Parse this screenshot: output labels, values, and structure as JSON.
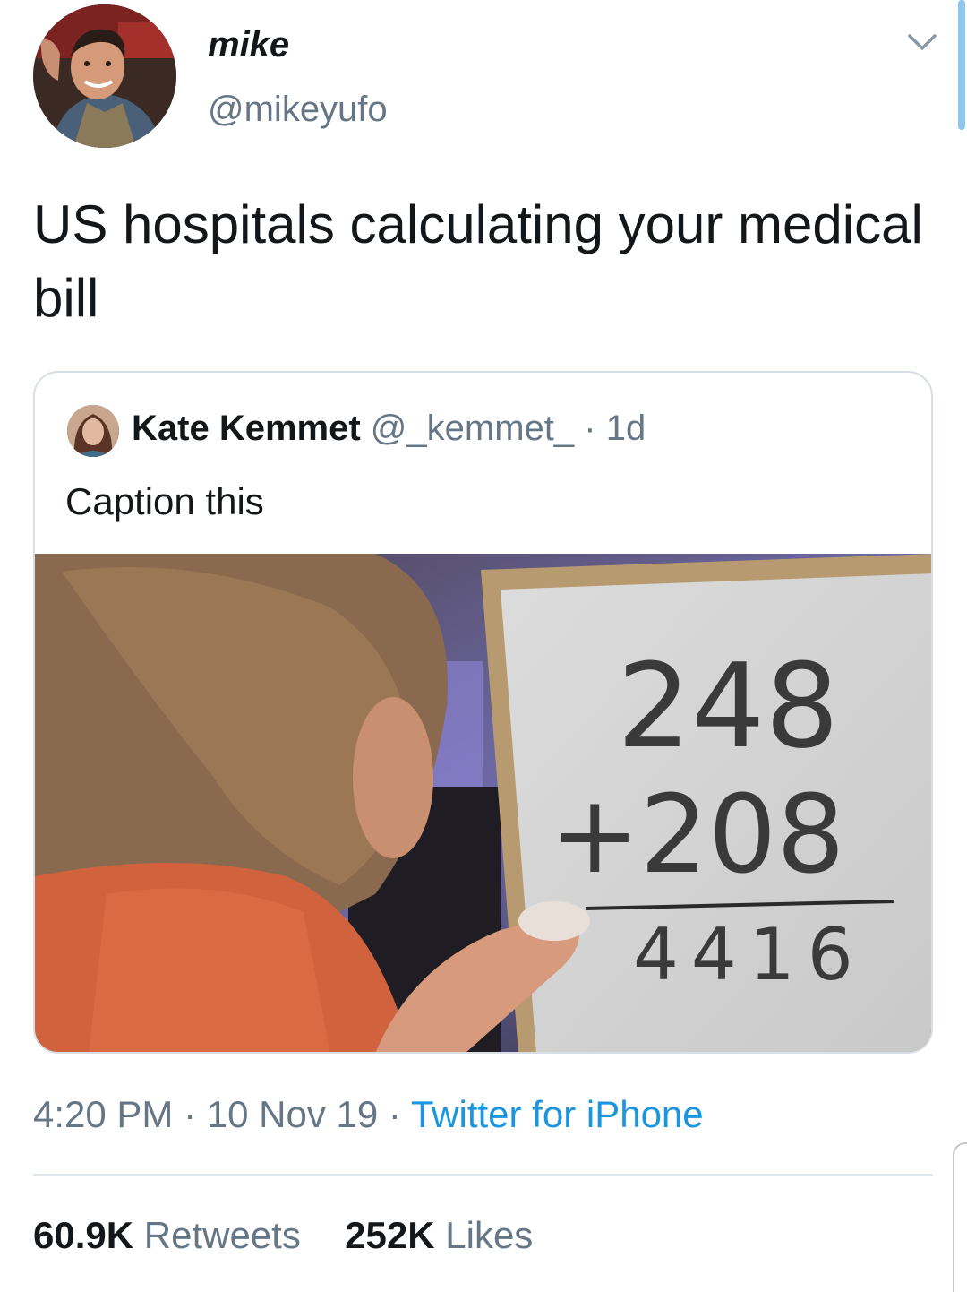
{
  "author": {
    "display_name": "mike",
    "handle": "@mikeyufo"
  },
  "tweet": {
    "text": "US hospitals calculating your medical bill"
  },
  "quoted_tweet": {
    "author_name": "Kate Kemmet",
    "author_handle": "@_kemmet_",
    "separator": "·",
    "age": "1d",
    "text": "Caption this",
    "media": {
      "whiteboard_line1": "248",
      "whiteboard_line2": "+208",
      "whiteboard_result": "4416"
    }
  },
  "meta": {
    "time": "4:20 PM",
    "separator": "·",
    "date": "10 Nov 19",
    "source": "Twitter for iPhone"
  },
  "stats": {
    "retweets_count": "60.9K",
    "retweets_label": "Retweets",
    "likes_count": "252K",
    "likes_label": "Likes"
  },
  "colors": {
    "link": "#1b95e0",
    "secondary_text": "#657786",
    "primary_text": "#14171a",
    "border": "#d8dee3"
  },
  "icons": {
    "menu": "chevron-down-icon"
  }
}
